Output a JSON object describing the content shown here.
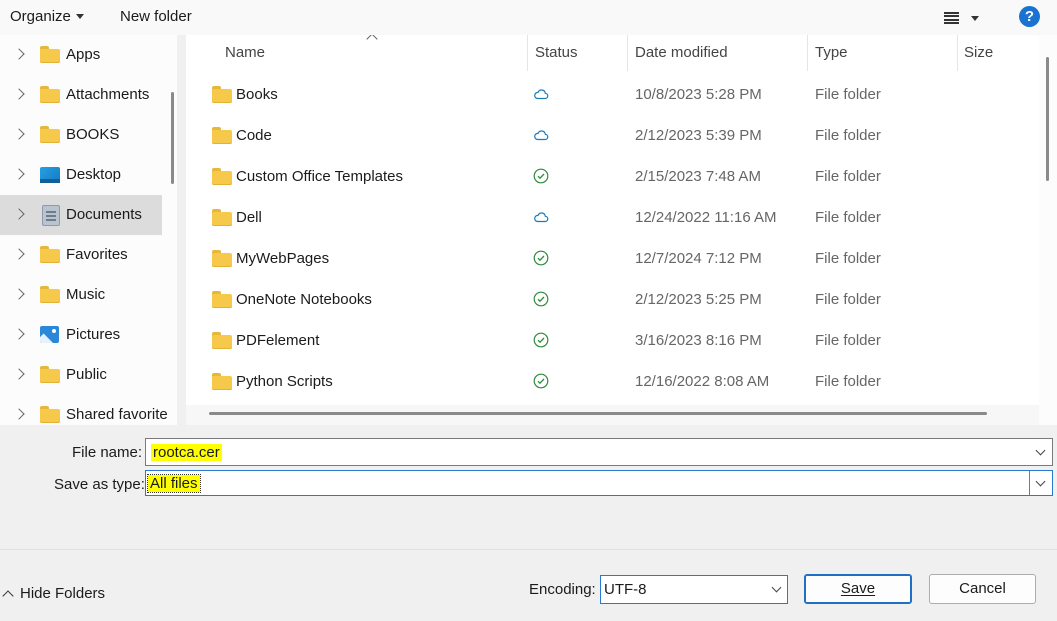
{
  "toolbar": {
    "organize_label": "Organize",
    "new_folder_label": "New folder",
    "help_label": "?"
  },
  "nav": {
    "items": [
      {
        "label": "Apps",
        "icon": "folder-icon"
      },
      {
        "label": "Attachments",
        "icon": "folder-icon"
      },
      {
        "label": "BOOKS",
        "icon": "folder-icon"
      },
      {
        "label": "Desktop",
        "icon": "desktop-icon"
      },
      {
        "label": "Documents",
        "icon": "documents-icon",
        "selected": true
      },
      {
        "label": "Favorites",
        "icon": "folder-icon"
      },
      {
        "label": "Music",
        "icon": "folder-icon"
      },
      {
        "label": "Pictures",
        "icon": "pictures-icon"
      },
      {
        "label": "Public",
        "icon": "folder-icon"
      },
      {
        "label": "Shared favorite",
        "icon": "folder-icon"
      }
    ]
  },
  "list": {
    "columns": {
      "name": "Name",
      "status": "Status",
      "date": "Date modified",
      "type": "Type",
      "size": "Size"
    },
    "rows": [
      {
        "name": "Books",
        "status": "cloud",
        "date": "10/8/2023 5:28 PM",
        "type": "File folder"
      },
      {
        "name": "Code",
        "status": "cloud",
        "date": "2/12/2023 5:39 PM",
        "type": "File folder"
      },
      {
        "name": "Custom Office Templates",
        "status": "synced",
        "date": "2/15/2023 7:48 AM",
        "type": "File folder"
      },
      {
        "name": "Dell",
        "status": "cloud",
        "date": "12/24/2022 11:16 AM",
        "type": "File folder"
      },
      {
        "name": "MyWebPages",
        "status": "synced",
        "date": "12/7/2024 7:12 PM",
        "type": "File folder"
      },
      {
        "name": "OneNote Notebooks",
        "status": "synced",
        "date": "2/12/2023 5:25 PM",
        "type": "File folder"
      },
      {
        "name": "PDFelement",
        "status": "synced",
        "date": "3/16/2023 8:16 PM",
        "type": "File folder"
      },
      {
        "name": "Python Scripts",
        "status": "synced",
        "date": "12/16/2022 8:08 AM",
        "type": "File folder"
      }
    ]
  },
  "form": {
    "file_name_label": "File name:",
    "file_name_value": "rootca.cer",
    "save_type_label": "Save as type:",
    "save_type_value": "All files",
    "encoding_label": "Encoding:",
    "encoding_value": "UTF-8"
  },
  "footer": {
    "hide_folders_label": "Hide Folders",
    "save_label": "Save",
    "cancel_label": "Cancel"
  },
  "colors": {
    "highlight": "#ffff00",
    "accent": "#1a73d1",
    "cloud_status": "#1a7bb8",
    "synced_status": "#2e8b3e",
    "folder": "#f7c94b"
  }
}
